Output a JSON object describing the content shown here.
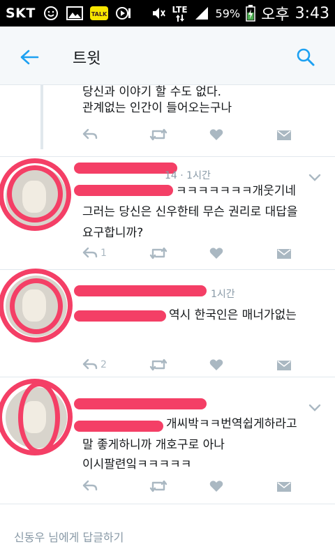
{
  "status_bar": {
    "carrier": "SKT",
    "network": "LTE",
    "battery": "59%",
    "ampm": "오후",
    "time": "3:43",
    "kakao_label": "TALK"
  },
  "header": {
    "title": "트윗",
    "back_icon": "arrow-left-icon",
    "search_icon": "search-icon"
  },
  "colors": {
    "accent": "#1da1f2",
    "redaction": "#f43f66",
    "muted": "#aab8c2"
  },
  "tweets": [
    {
      "lines": [
        "당신과 이야기 할 수도 없다.",
        "관계없는 인간이 들어오는구나"
      ]
    },
    {
      "meta": "14 · 1시간",
      "line0_suffix": "ㅋㅋㅋㅋㅋㅋㅋ개웃기네",
      "lines": [
        "그러는 당신은 신우한테 무슨 권리로 대답을",
        "요구합니까?"
      ],
      "reply_count": "1"
    },
    {
      "meta": "1시간",
      "line0_suffix": "역시 한국인은 매너가없는",
      "reply_count": "2"
    },
    {
      "line0_suffix": "개씨박ㅋㅋ번역쉽게하라고",
      "lines": [
        "말 좋게하니까 개호구로 아나",
        "이시팔련잌ㅋㅋㅋㅋㅋ"
      ]
    }
  ],
  "reply_box": {
    "placeholder": "신동우 님에게 답글하기"
  }
}
